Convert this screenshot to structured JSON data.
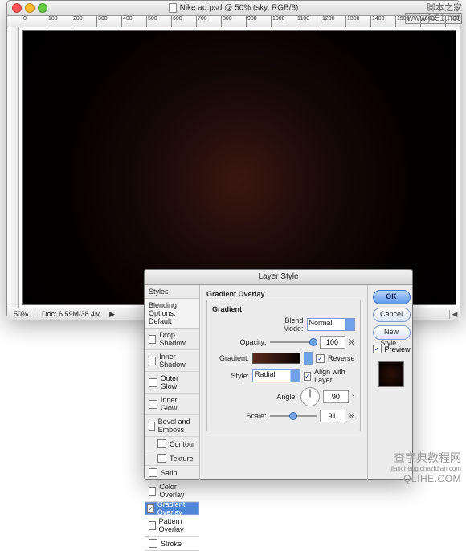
{
  "window": {
    "title": "Nike ad.psd @ 50% (sky, RGB/8)",
    "zoom": "50%",
    "docsize": "Doc: 6.59M/38.4M",
    "ruler_ticks": [
      "0",
      "100",
      "200",
      "300",
      "400",
      "500",
      "600",
      "700",
      "800",
      "900",
      "1000",
      "1100",
      "1200",
      "1300",
      "1400",
      "1500",
      "1600",
      "1700"
    ]
  },
  "dialog": {
    "title": "Layer Style",
    "styles_header": "Styles",
    "blending_options": "Blending Options: Default",
    "items": {
      "drop_shadow": "Drop Shadow",
      "inner_shadow": "Inner Shadow",
      "outer_glow": "Outer Glow",
      "inner_glow": "Inner Glow",
      "bevel": "Bevel and Emboss",
      "contour": "Contour",
      "texture": "Texture",
      "satin": "Satin",
      "color_overlay": "Color Overlay",
      "gradient_overlay": "Gradient Overlay",
      "pattern_overlay": "Pattern Overlay",
      "stroke": "Stroke"
    },
    "group_title": "Gradient Overlay",
    "group_sub": "Gradient",
    "labels": {
      "blend_mode": "Blend Mode:",
      "opacity": "Opacity:",
      "gradient": "Gradient:",
      "reverse": "Reverse",
      "style": "Style:",
      "align": "Align with Layer",
      "angle": "Angle:",
      "scale": "Scale:"
    },
    "values": {
      "blend_mode": "Normal",
      "opacity": "100",
      "style": "Radial",
      "angle": "90",
      "scale": "91"
    },
    "buttons": {
      "ok": "OK",
      "cancel": "Cancel",
      "new_style": "New Style...",
      "preview": "Preview"
    }
  },
  "watermark": {
    "top_line1": "脚本之家",
    "top_line2": "www.jb51.net",
    "bottom_cn": "查字典教程网",
    "bottom_sub": "jiaocheng.chazidian.com",
    "bottom_brand": "QLIHE.COM"
  }
}
